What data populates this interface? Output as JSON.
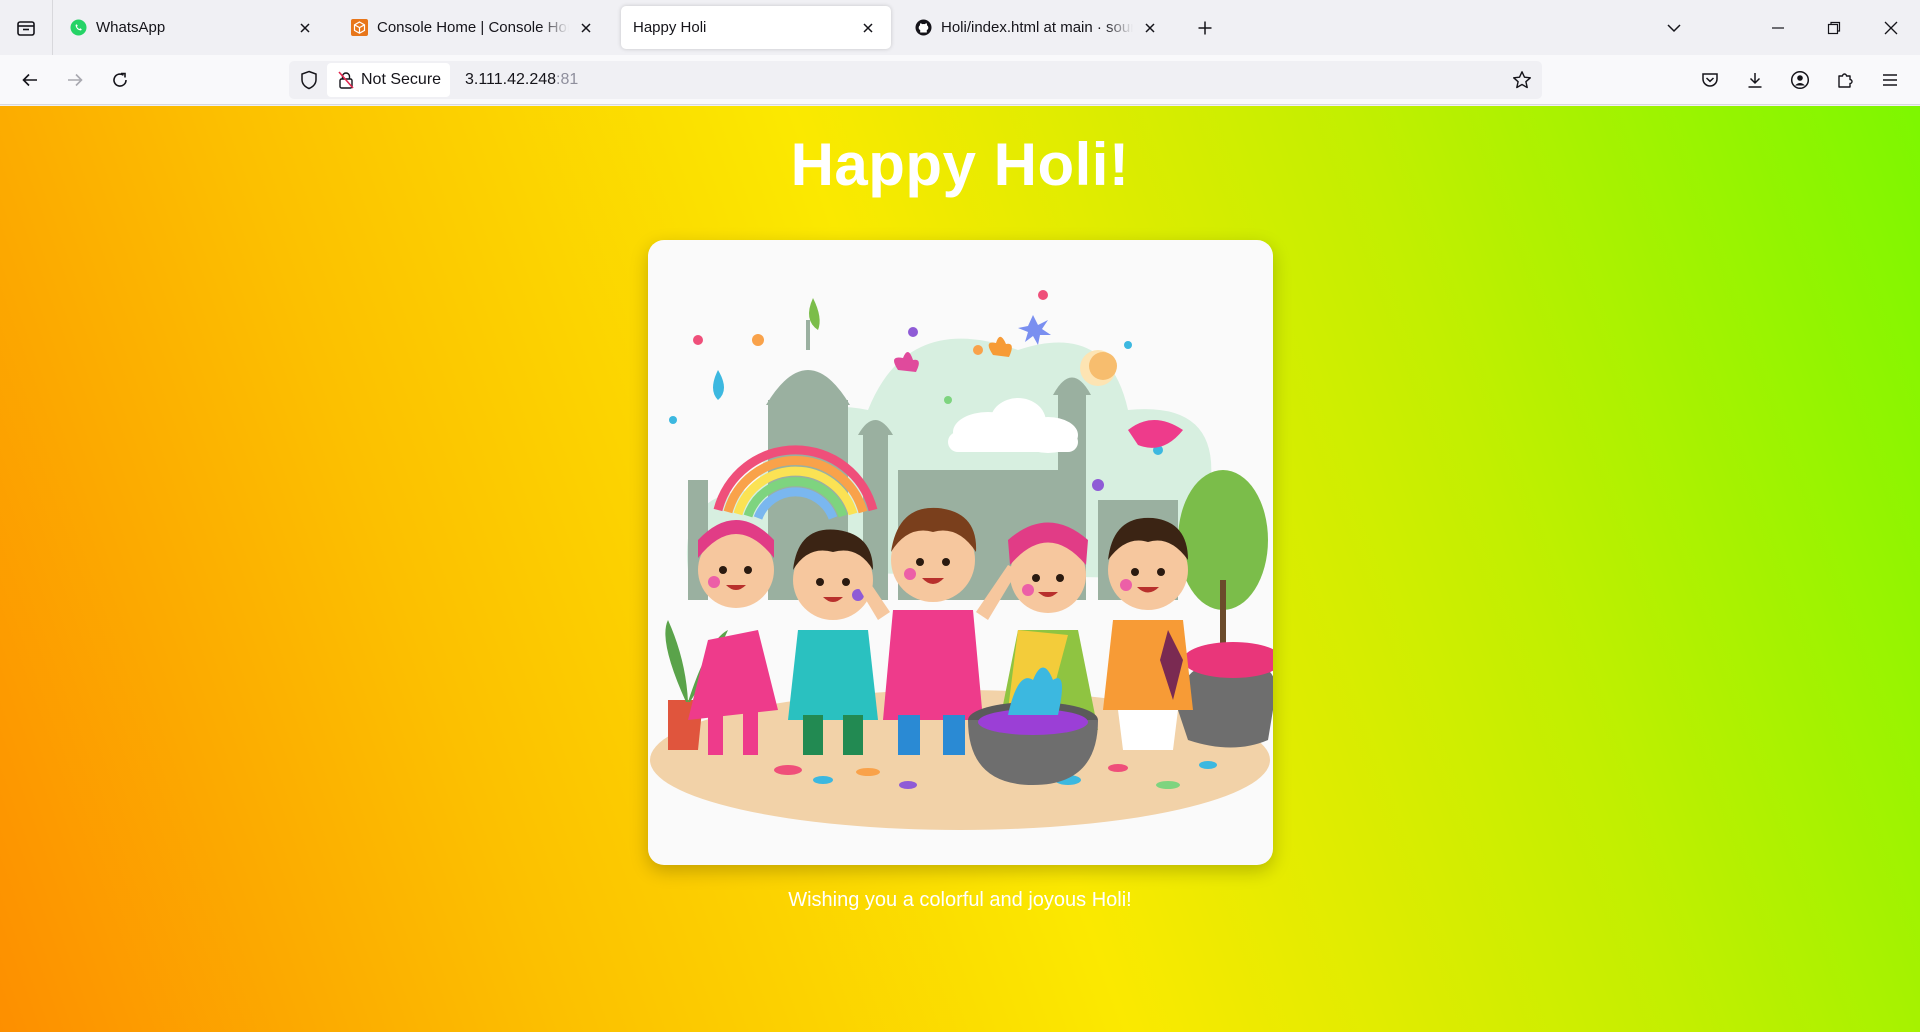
{
  "browser": {
    "tabs": [
      {
        "title": "WhatsApp",
        "favicon": "whatsapp-icon",
        "active": false
      },
      {
        "title": "Console Home | Console Home",
        "favicon": "aws-console-icon",
        "active": false
      },
      {
        "title": "Happy Holi",
        "favicon": "",
        "active": true
      },
      {
        "title": "Holi/index.html at main · sourav",
        "favicon": "github-icon",
        "active": false
      }
    ],
    "security_label": "Not Secure",
    "url_host": "3.111.42.248",
    "url_port": ":81"
  },
  "page": {
    "heading": "Happy Holi!",
    "image_alt": "Children celebrating Holi with colors",
    "caption": "Wishing you a colorful and joyous Holi!"
  },
  "colors": {
    "gradient": [
      "#7df700",
      "#c2ef00",
      "#fbe900",
      "#fcc000",
      "#fd8f00"
    ],
    "text": "#ffffff"
  }
}
